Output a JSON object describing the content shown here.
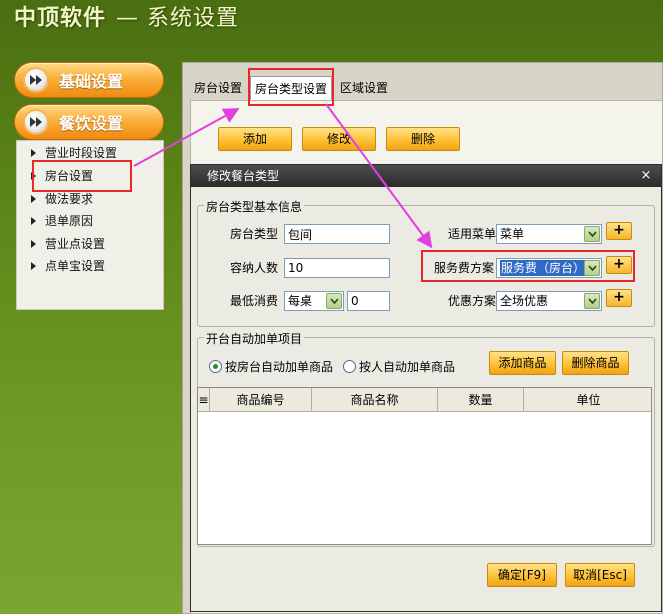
{
  "app": {
    "brand": "中顶软件",
    "dash": "—",
    "section": "系统设置"
  },
  "nav": {
    "basic": "基础设置",
    "catering": "餐饮设置",
    "items": [
      "营业时段设置",
      "房台设置",
      "做法要求",
      "退单原因",
      "营业点设置",
      "点单宝设置"
    ]
  },
  "tabs": [
    "房台设置",
    "房台类型设置",
    "区域设置"
  ],
  "toolbar": {
    "add": "添加",
    "edit": "修改",
    "delete": "删除"
  },
  "dialog": {
    "title": "修改餐台类型",
    "close": "×",
    "basic_group": "房台类型基本信息",
    "fields": {
      "type_label": "房台类型",
      "type_value": "包间",
      "capacity_label": "容纳人数",
      "capacity_value": "10",
      "min_label": "最低消费",
      "min_mode": "每桌",
      "min_value": "0",
      "menu_label": "适用菜单",
      "menu_value": "菜单",
      "service_label": "服务费方案",
      "service_value": "服务费（房台）",
      "discount_label": "优惠方案",
      "discount_value": "全场优惠",
      "plus": "+"
    },
    "auto_group": "开台自动加单项目",
    "radio_room": "按房台自动加单商品",
    "radio_person": "按人自动加单商品",
    "add_goods": "添加商品",
    "del_goods": "删除商品",
    "columns": [
      "商品编号",
      "商品名称",
      "数量",
      "单位"
    ],
    "ok": "确定[F9]",
    "cancel": "取消[Esc]"
  },
  "colors": {
    "highlight": "#e8262c",
    "arrow": "#e040e0",
    "accent": "#f5a623"
  }
}
